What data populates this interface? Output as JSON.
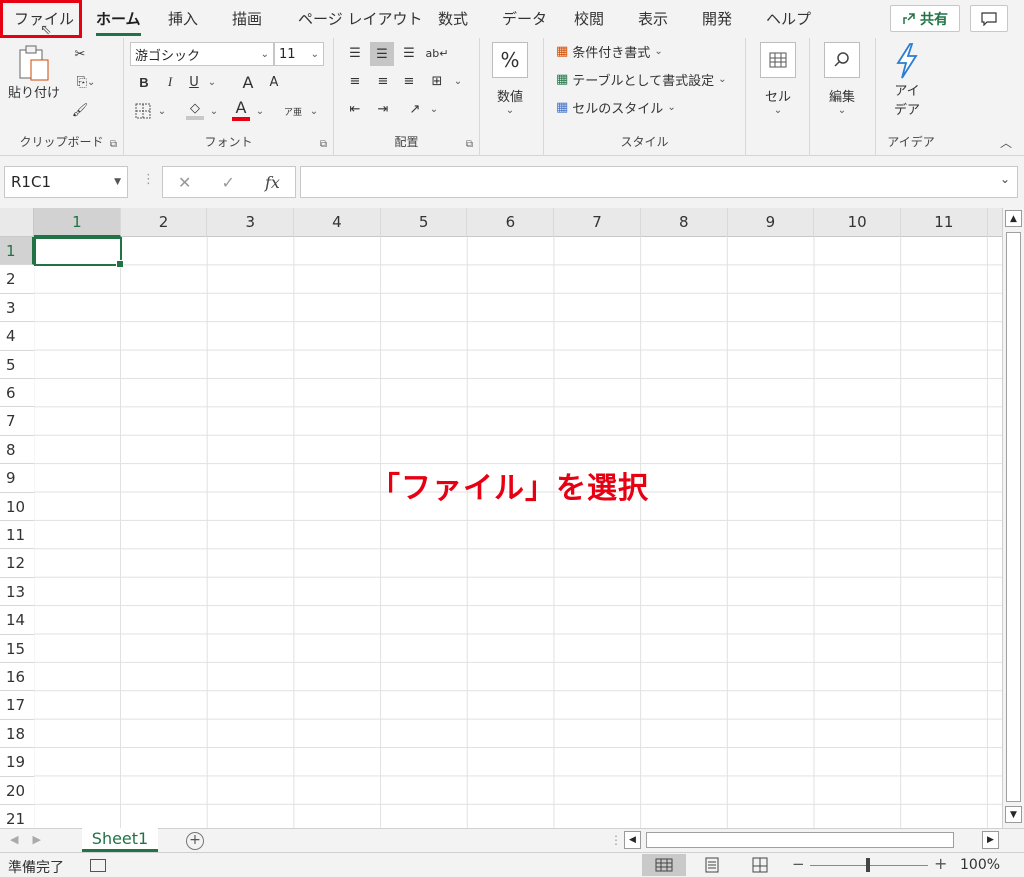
{
  "tabs": [
    {
      "label": "ファイル",
      "active": false
    },
    {
      "label": "ホーム",
      "active": true
    },
    {
      "label": "挿入",
      "active": false
    },
    {
      "label": "描画",
      "active": false
    },
    {
      "label": "ページ レイアウト",
      "active": false
    },
    {
      "label": "数式",
      "active": false
    },
    {
      "label": "データ",
      "active": false
    },
    {
      "label": "校閲",
      "active": false
    },
    {
      "label": "表示",
      "active": false
    },
    {
      "label": "開発",
      "active": false
    },
    {
      "label": "ヘルプ",
      "active": false
    }
  ],
  "share_label": "共有",
  "ribbon": {
    "clipboard": {
      "label": "クリップボード",
      "paste_label": "貼り付け"
    },
    "font": {
      "label": "フォント",
      "font_name": "游ゴシック",
      "font_size": "11",
      "bold": "B",
      "italic": "I",
      "underline": "U",
      "grow": "A",
      "shrink": "A",
      "font_color": "A",
      "phonetic": "ア亜"
    },
    "alignment": {
      "label": "配置"
    },
    "number": {
      "label": "数値",
      "symbol": "%"
    },
    "styles": {
      "label": "スタイル",
      "items": [
        "条件付き書式",
        "テーブルとして書式設定",
        "セルのスタイル"
      ]
    },
    "cells": {
      "label": "セル"
    },
    "editing": {
      "label": "編集"
    },
    "ideas": {
      "label": "アイデア",
      "button_label_1": "アイ",
      "button_label_2": "デア"
    }
  },
  "formula_bar": {
    "name_box": "R1C1",
    "cancel": "✕",
    "enter": "✓",
    "fx": "fx",
    "value": ""
  },
  "columns": [
    "1",
    "2",
    "3",
    "4",
    "5",
    "6",
    "7",
    "8",
    "9",
    "10",
    "11"
  ],
  "rows": [
    "1",
    "2",
    "3",
    "4",
    "5",
    "6",
    "7",
    "8",
    "9",
    "10",
    "11",
    "12",
    "13",
    "14",
    "15",
    "16",
    "17",
    "18",
    "19",
    "20",
    "21"
  ],
  "annotation": "「ファイル」を選択",
  "sheet_tab": "Sheet1",
  "status": {
    "text": "準備完了",
    "zoom": "100%"
  },
  "colors": {
    "accent": "#217346",
    "highlight": "#e60012"
  }
}
